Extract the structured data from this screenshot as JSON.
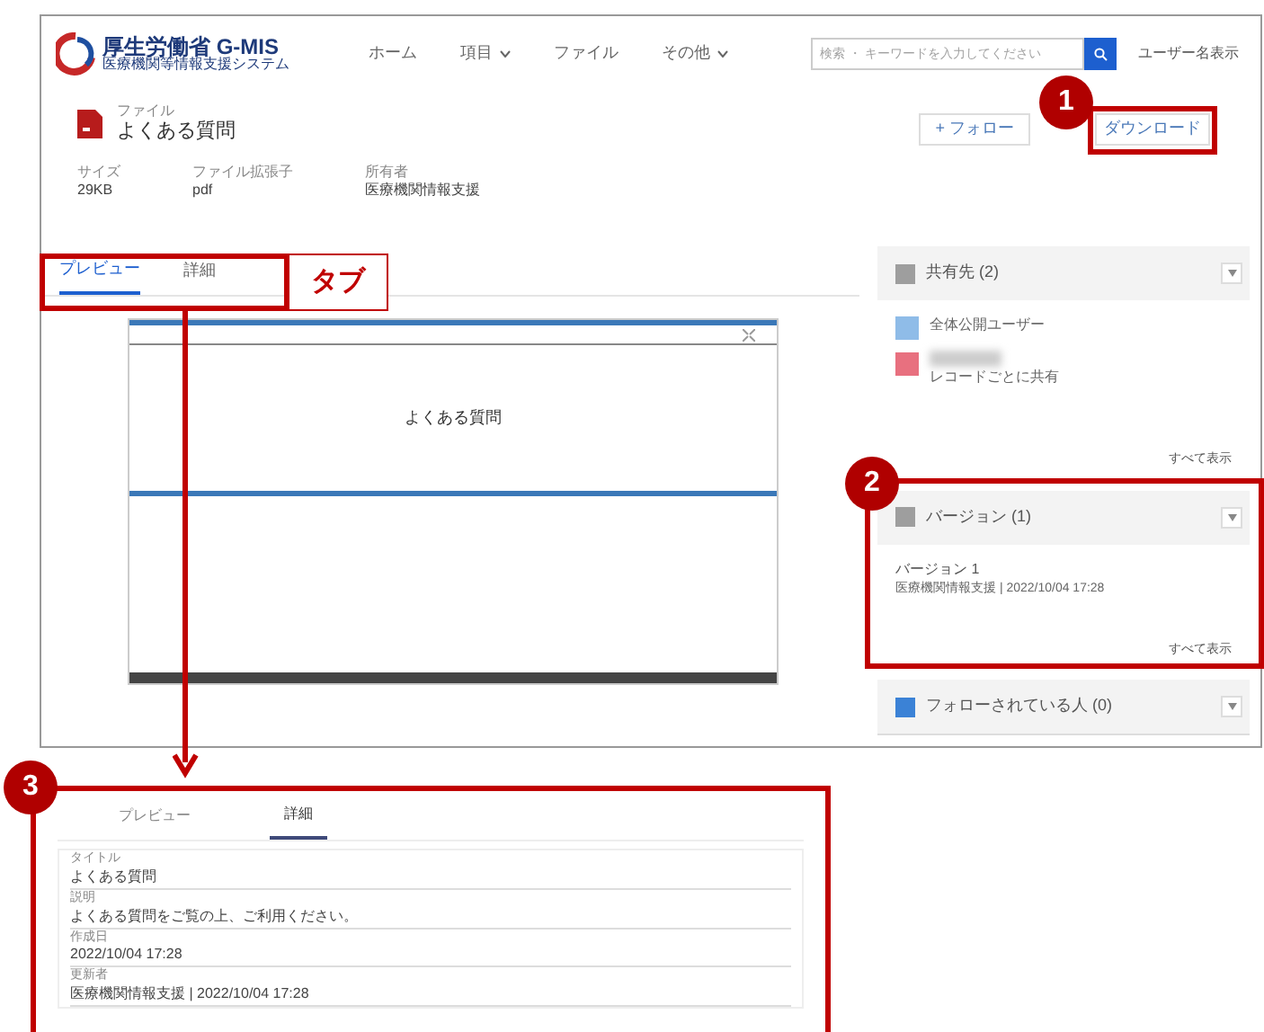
{
  "header": {
    "logo_title": "厚生労働省 G-MIS",
    "logo_subtitle": "医療機関等情報支援システム",
    "nav": [
      {
        "label": "ホーム",
        "dropdown": false
      },
      {
        "label": "項目",
        "dropdown": true
      },
      {
        "label": "ファイル",
        "dropdown": false
      },
      {
        "label": "その他",
        "dropdown": true
      }
    ],
    "search": {
      "placeholder": "検索 ・ キーワードを入力してください"
    },
    "user": "ユーザー名表示"
  },
  "record": {
    "type_label": "ファイル",
    "title": "よくある質問",
    "fields": [
      {
        "label": "サイズ",
        "value": "29KB"
      },
      {
        "label": "ファイル拡張子",
        "value": "pdf"
      },
      {
        "label": "所有者",
        "value": "医療機関情報支援"
      }
    ],
    "buttons": [
      {
        "label": "+ フォロー"
      },
      {
        "label": "ダウンロード"
      }
    ]
  },
  "tabs": [
    {
      "label": "プレビュー",
      "selected": true
    },
    {
      "label": "詳細",
      "selected": false
    }
  ],
  "tab_callout": "タブ",
  "preview": {
    "text": "よくある質問"
  },
  "sidebar": [
    {
      "title": "共有先 (2)",
      "color": "#9e9e9e",
      "items": [
        {
          "kind": "public",
          "color": "#8fbce8",
          "text": "全体公開ユーザー"
        },
        {
          "kind": "blurred",
          "color": "#e8707f",
          "text": "レコードごとに共有"
        }
      ],
      "footer": "すべて表示"
    },
    {
      "title": "バージョン (1)",
      "color": "#9e9e9e",
      "items": [
        {
          "kind": "version",
          "title": "バージョン 1",
          "text": "医療機関情報支援 | 2022/10/04 17:28"
        }
      ],
      "footer": "すべて表示"
    },
    {
      "title": "フォローされている人 (0)",
      "color": "#3b82d6"
    }
  ],
  "detail": {
    "tabs": [
      {
        "label": "プレビュー",
        "selected": false
      },
      {
        "label": "詳細",
        "selected": true
      }
    ],
    "fields": [
      {
        "label": "タイトル",
        "value": "よくある質問"
      },
      {
        "label": "説明",
        "value": "よくある質問をご覧の上、ご利用ください。"
      },
      {
        "label": "作成日",
        "value": "2022/10/04 17:28"
      },
      {
        "label": "更新者",
        "value": "医療機関情報支援 | 2022/10/04 17:28"
      }
    ]
  },
  "markers": [
    "1",
    "2",
    "3"
  ]
}
